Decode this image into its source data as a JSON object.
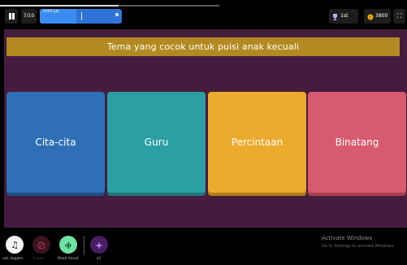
{
  "topbar": {
    "progress": 0.54,
    "counter": "7/10",
    "timer": {
      "text": "4300 pts",
      "fill": 0.45
    },
    "rank": {
      "icon": "trophy-icon",
      "label": "1st"
    },
    "coins": {
      "icon": "coin-icon",
      "label": "3800"
    },
    "fullscreen_icon": "fullscreen-icon"
  },
  "question": {
    "text": "Tema yang cocok untuk puisi anak kecuali"
  },
  "options": [
    {
      "label": "Cita-cita",
      "color": "#2f6fb5"
    },
    {
      "label": "Guru",
      "color": "#2aa0a5"
    },
    {
      "label": "Percintaan",
      "color": "#ecaa2c"
    },
    {
      "label": "Binatang",
      "color": "#d85a6e"
    }
  ],
  "powerups": [
    {
      "label": "ask degate..",
      "icon": "music-note-icon"
    },
    {
      "label": "Eraser",
      "icon": "eraser-icon"
    },
    {
      "label": "Read Aloud",
      "icon": "read-aloud-icon"
    },
    {
      "label": "x1",
      "icon": "power-up-icon"
    }
  ],
  "watermark": {
    "title": "Activate Windows",
    "subtitle": "Go to Settings to activate Windows."
  },
  "colors": {
    "quiz_background": "#461c3e",
    "question_bar": "#b38a21",
    "timer_bar": "#2f73d8"
  }
}
